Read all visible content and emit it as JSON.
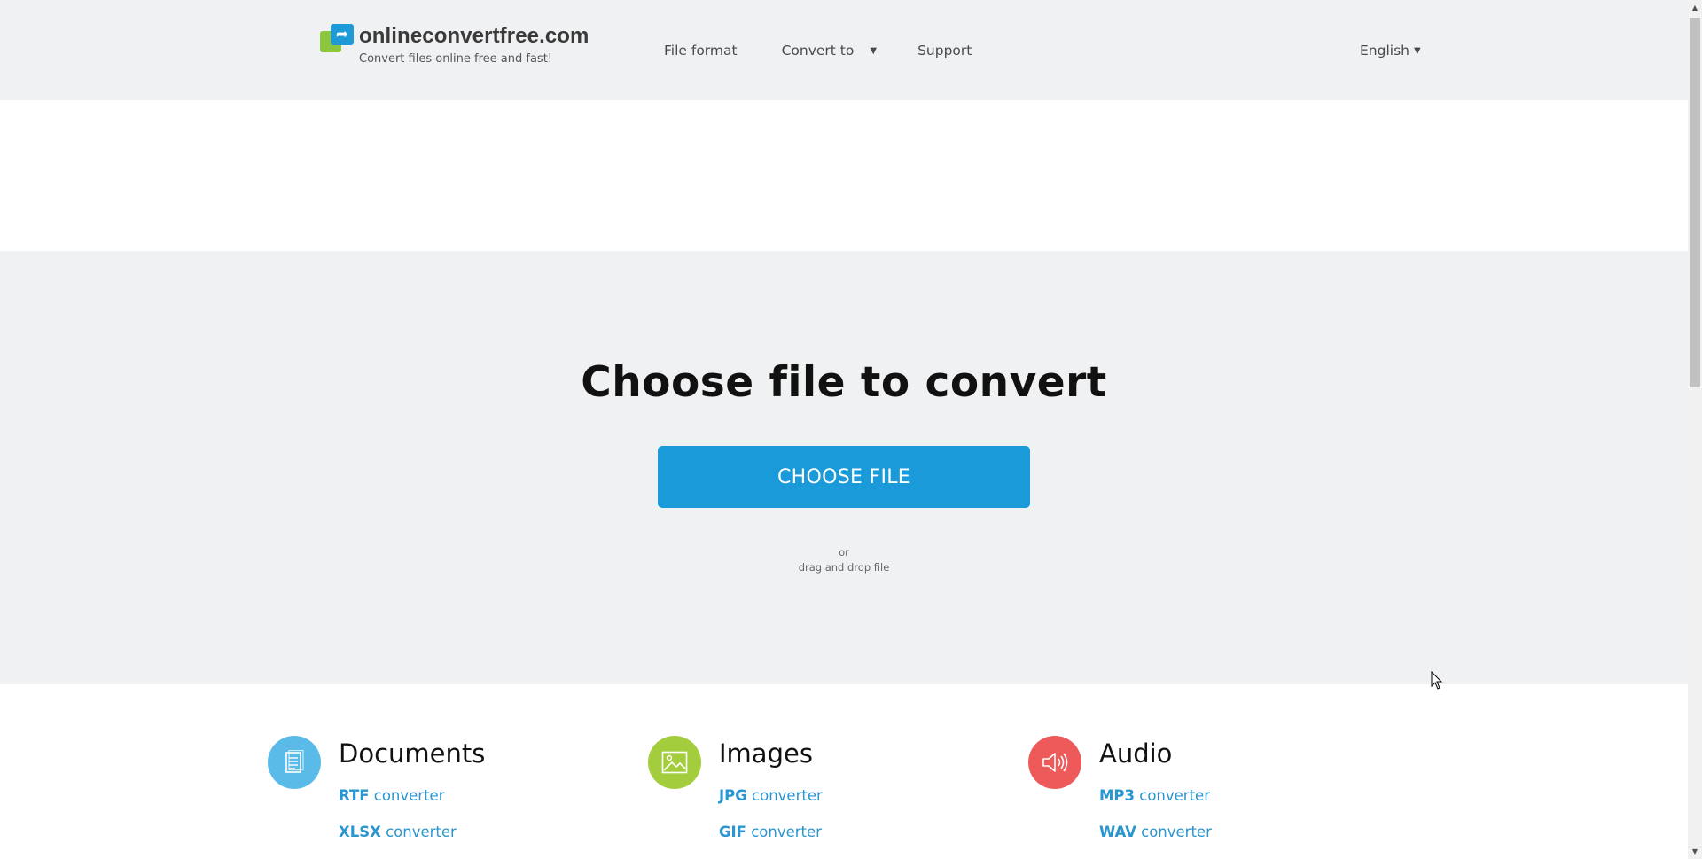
{
  "header": {
    "logo_name": "onlineconvertfree.com",
    "logo_tagline": "Convert files online free and fast!",
    "nav": {
      "file_format": "File format",
      "convert_to": "Convert to",
      "support": "Support"
    },
    "language": "English"
  },
  "hero": {
    "title": "Choose file to convert",
    "button": "CHOOSE FILE",
    "or": "or",
    "drag_drop": "drag and drop file"
  },
  "categories": [
    {
      "title": "Documents",
      "icon": "document-icon",
      "color": "#5bbbe8",
      "links": [
        {
          "format": "RTF",
          "suffix": "converter"
        },
        {
          "format": "XLSX",
          "suffix": "converter"
        }
      ]
    },
    {
      "title": "Images",
      "icon": "image-icon",
      "color": "#a3cd3d",
      "links": [
        {
          "format": "JPG",
          "suffix": "converter"
        },
        {
          "format": "GIF",
          "suffix": "converter"
        }
      ]
    },
    {
      "title": "Audio",
      "icon": "speaker-icon",
      "color": "#ee5a5a",
      "links": [
        {
          "format": "MP3",
          "suffix": "converter"
        },
        {
          "format": "WAV",
          "suffix": "converter"
        }
      ]
    }
  ],
  "colors": {
    "accent": "#1a9ad9",
    "link": "#2a95cf",
    "header_bg": "#f0f1f3"
  }
}
